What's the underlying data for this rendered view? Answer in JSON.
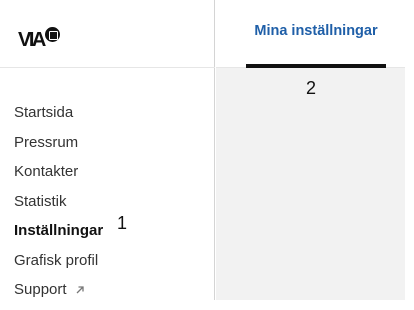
{
  "logo": {
    "text": "VIA"
  },
  "sidebar": {
    "items": [
      {
        "label": "Startsida"
      },
      {
        "label": "Pressrum"
      },
      {
        "label": "Kontakter"
      },
      {
        "label": "Statistik"
      },
      {
        "label": "Inställningar",
        "active": true
      },
      {
        "label": "Grafisk profil"
      },
      {
        "label": "Support",
        "icon": "external-link-icon"
      }
    ]
  },
  "tabs": [
    {
      "label": "Mina inställningar",
      "active": true
    }
  ],
  "annotations": {
    "one": "1",
    "two": "2"
  },
  "colors": {
    "tab_text": "#1f5fa8",
    "underline": "#111111",
    "content_bg": "#f2f2f2"
  }
}
